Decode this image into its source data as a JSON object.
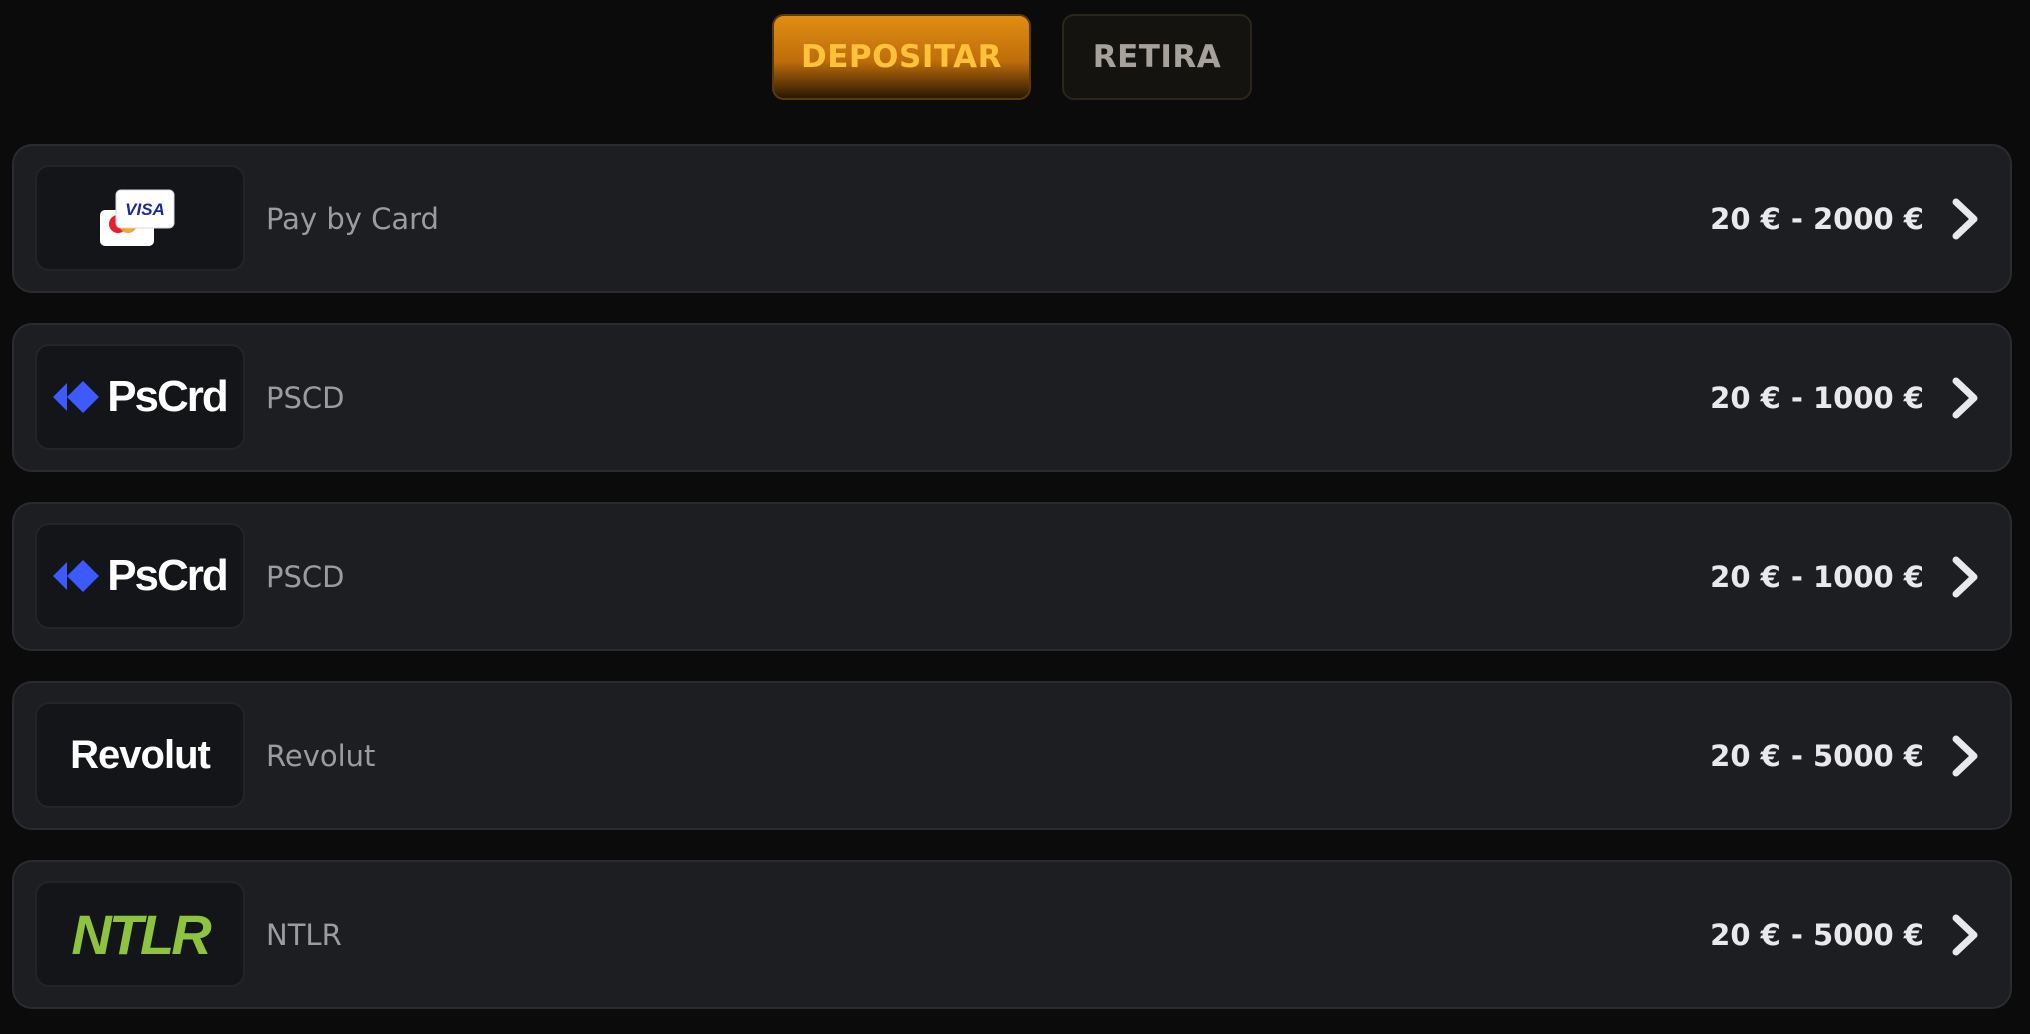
{
  "tabs": {
    "deposit_label": "DEPOSITAR",
    "withdraw_label": "RETIRA",
    "active": "deposit"
  },
  "methods": [
    {
      "logo": "visa-mastercard-icon",
      "name": "Pay by Card",
      "range": "20 € - 2000 €"
    },
    {
      "logo": "pscrd-logo",
      "logo_text": "PsCrd",
      "name": "PSCD",
      "range": "20 € - 1000 €"
    },
    {
      "logo": "pscrd-logo",
      "logo_text": "PsCrd",
      "name": "PSCD",
      "range": "20 € - 1000 €"
    },
    {
      "logo": "revolut-logo",
      "logo_text": "Revolut",
      "name": "Revolut",
      "range": "20 € - 5000 €"
    },
    {
      "logo": "ntlr-logo",
      "logo_text": "NTLR",
      "name": "NTLR",
      "range": "20 € - 5000 €"
    }
  ],
  "visa_label": "VISA",
  "colors": {
    "accent": "#ffc23a",
    "ntlr_green": "#8dc33f",
    "pscrd_blue": "#3d5afe",
    "row_bg": "#1d1e21",
    "page_bg": "#0b0b0c"
  }
}
